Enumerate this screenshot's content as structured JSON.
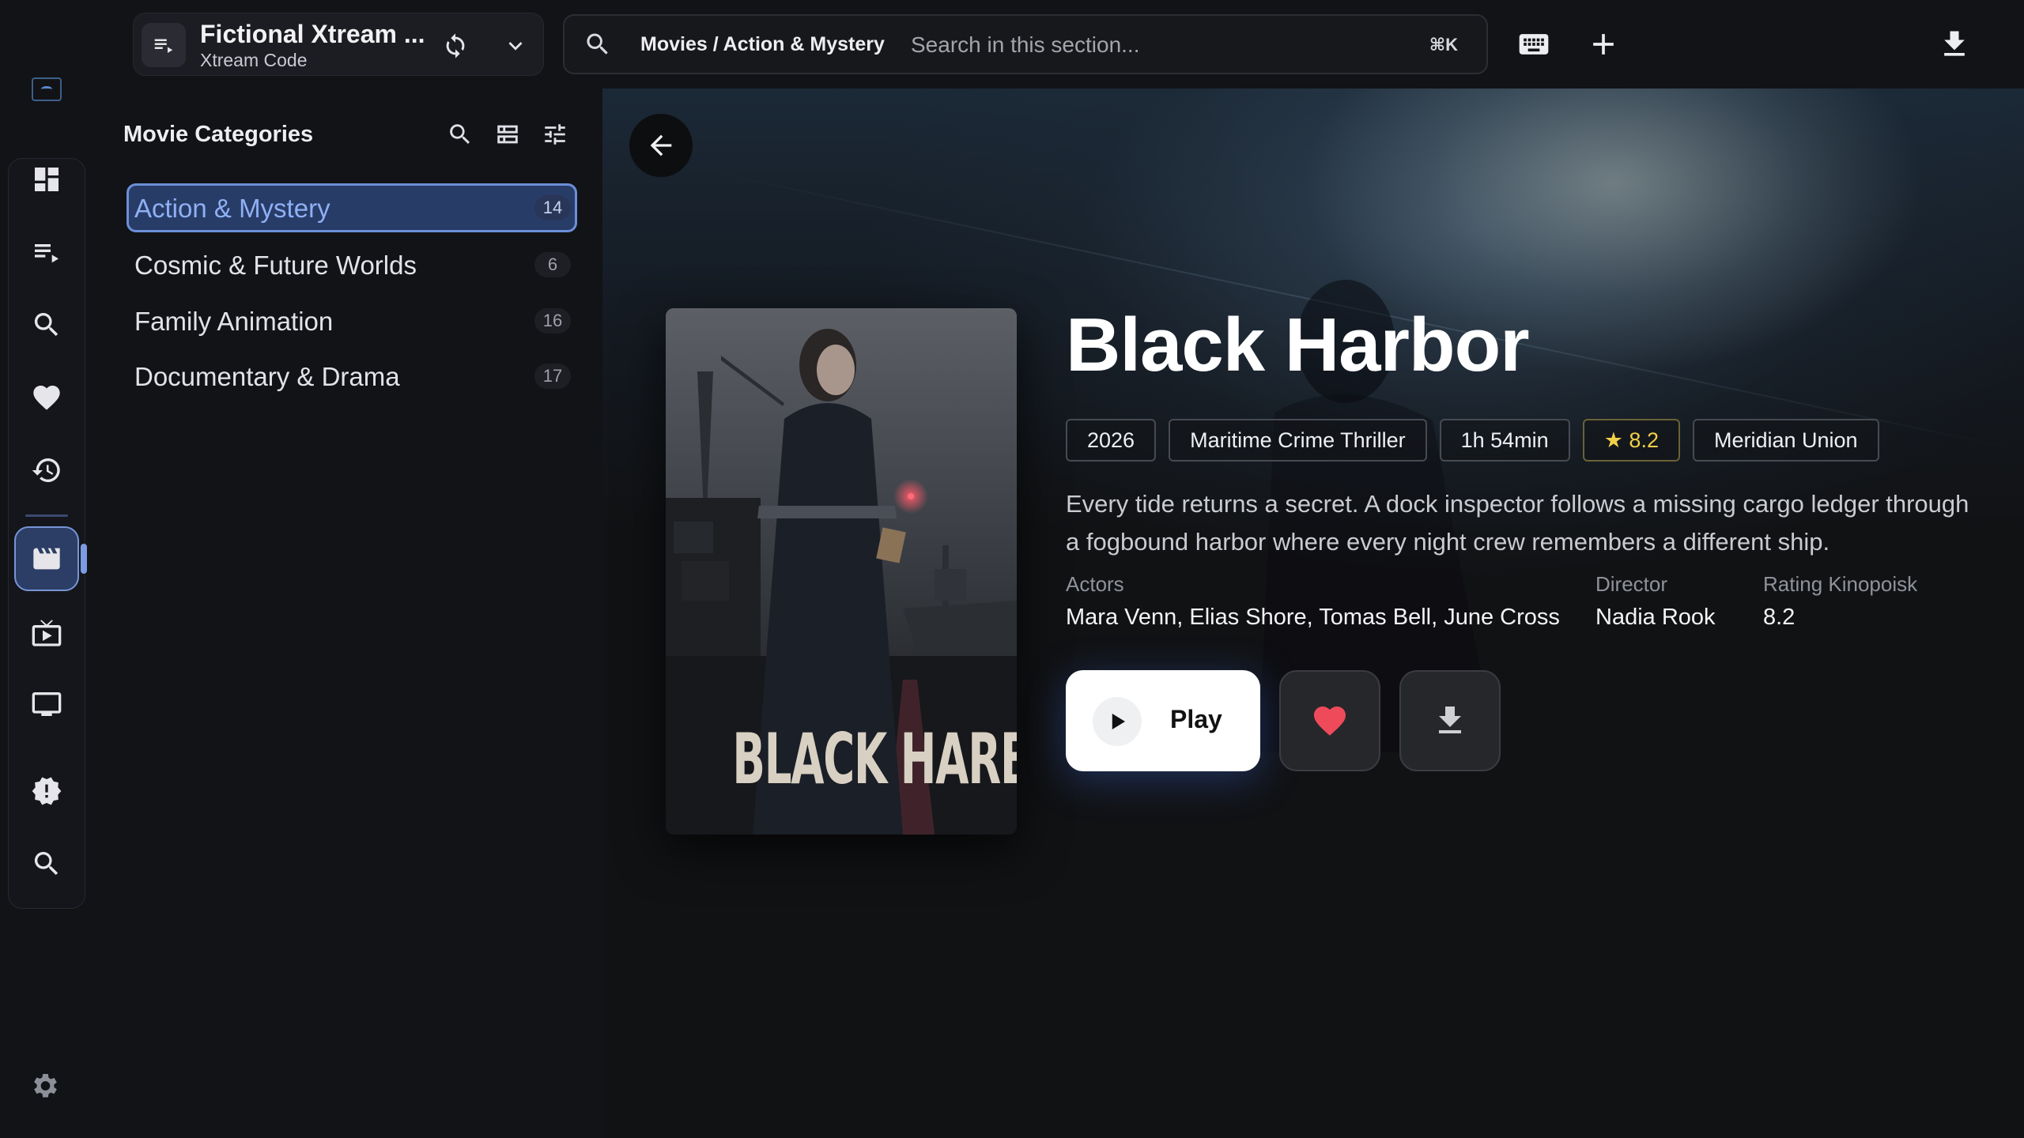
{
  "colors": {
    "accent": "#7d9be0",
    "background": "#121317",
    "favorite": "#ef4a5a",
    "rating": "#f2cf48"
  },
  "rail": {
    "items": [
      {
        "icon": "dashboard-icon"
      },
      {
        "icon": "playlist-icon"
      },
      {
        "icon": "search-icon"
      },
      {
        "icon": "favorites-heart-icon"
      },
      {
        "icon": "history-icon"
      },
      {
        "icon": "movies-clapperboard-icon",
        "active": true
      },
      {
        "icon": "series-tv-play-icon"
      },
      {
        "icon": "live-tv-monitor-icon"
      },
      {
        "icon": "alert-badge-icon"
      },
      {
        "icon": "global-search-icon"
      }
    ],
    "settings_icon": "settings-gear-icon"
  },
  "source": {
    "title": "Fictional Xtream ...",
    "subtitle": "Xtream Code"
  },
  "search": {
    "breadcrumb": "Movies / Action & Mystery",
    "placeholder": "Search in this section...",
    "shortcut": "⌘K"
  },
  "categories": {
    "title": "Movie Categories",
    "items": [
      {
        "label": "Action & Mystery",
        "count": "14",
        "active": true
      },
      {
        "label": "Cosmic & Future Worlds",
        "count": "6"
      },
      {
        "label": "Family Animation",
        "count": "16"
      },
      {
        "label": "Documentary & Drama",
        "count": "17"
      }
    ]
  },
  "movie": {
    "title": "Black Harbor",
    "poster_text": "BLACK HARBOR",
    "year": "2026",
    "genre": "Maritime Crime Thriller",
    "duration": "1h 54min",
    "rating_chip": "8.2",
    "country": "Meridian Union",
    "description": "Every tide returns a secret. A dock inspector follows a missing cargo ledger through a fogbound harbor where every night crew remembers a different ship.",
    "actors_label": "Actors",
    "actors": "Mara Venn, Elias Shore, Tomas Bell, June Cross",
    "director_label": "Director",
    "director": "Nadia Rook",
    "rating_label": "Rating Kinopoisk",
    "rating": "8.2"
  },
  "actions": {
    "play_label": "Play"
  }
}
